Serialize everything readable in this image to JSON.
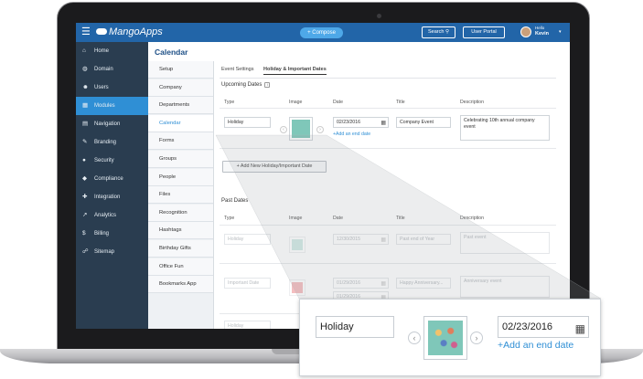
{
  "topbar": {
    "menu_icon": "hamburger-icon",
    "logo": "MangoApps",
    "compose_label": "+ Compose",
    "search_label": "Search",
    "portal_label": "User Portal",
    "greeting": "Hello",
    "user_name": "Kevin"
  },
  "page": {
    "title": "Calendar"
  },
  "sidebar": {
    "items": [
      {
        "label": "Home",
        "icon": "home-icon",
        "glyph": "⌂"
      },
      {
        "label": "Domain",
        "icon": "globe-icon",
        "glyph": "◍"
      },
      {
        "label": "Users",
        "icon": "users-icon",
        "glyph": "☻"
      },
      {
        "label": "Modules",
        "icon": "modules-icon",
        "glyph": "▦"
      },
      {
        "label": "Navigation",
        "icon": "navigation-icon",
        "glyph": "▤"
      },
      {
        "label": "Branding",
        "icon": "brush-icon",
        "glyph": "✎"
      },
      {
        "label": "Security",
        "icon": "lock-icon",
        "glyph": "●"
      },
      {
        "label": "Compliance",
        "icon": "shield-icon",
        "glyph": "◆"
      },
      {
        "label": "Integration",
        "icon": "wrench-icon",
        "glyph": "✚"
      },
      {
        "label": "Analytics",
        "icon": "chart-icon",
        "glyph": "↗"
      },
      {
        "label": "Billing",
        "icon": "dollar-icon",
        "glyph": "$"
      },
      {
        "label": "Sitemap",
        "icon": "sitemap-icon",
        "glyph": "☍"
      }
    ]
  },
  "submenu": {
    "items": [
      "Setup",
      "Company",
      "Departments",
      "Calendar",
      "Forms",
      "Groups",
      "People",
      "Files",
      "Recognition",
      "Hashtags",
      "Birthday Gifts",
      "Office Fun",
      "Bookmarks App"
    ]
  },
  "tabs": [
    "Event Settings",
    "Holiday & Important Dates"
  ],
  "upcoming": {
    "title": "Upcoming Dates",
    "columns": [
      "Type",
      "Image",
      "Date",
      "Title",
      "Description"
    ],
    "row": {
      "type": "Holiday",
      "date": "02/23/2016",
      "add_end_date": "+Add an end date",
      "title": "Company Event",
      "description": "Celebrating 10th annual company event"
    },
    "add_button": "+ Add New Holiday/Important Date"
  },
  "past": {
    "title": "Past Dates",
    "columns": [
      "Type",
      "Image",
      "Date",
      "Title",
      "Description"
    ],
    "rows": [
      {
        "type": "Holiday",
        "date": "12/30/2015",
        "title": "Past end of Year",
        "description": "Past event"
      },
      {
        "type": "Important Date",
        "date": "01/29/2016",
        "date2": "01/29/2016",
        "title": "Happy Anniversary...",
        "description": "Anniversary event"
      },
      {
        "type": "Holiday"
      }
    ]
  },
  "zoom": {
    "type": "Holiday",
    "date": "02/23/2016",
    "add_end_date": "+Add an end date"
  },
  "colors": {
    "topbar": "#2265a8",
    "sidebar": "#2a3d50",
    "accent": "#2f8fd5"
  }
}
